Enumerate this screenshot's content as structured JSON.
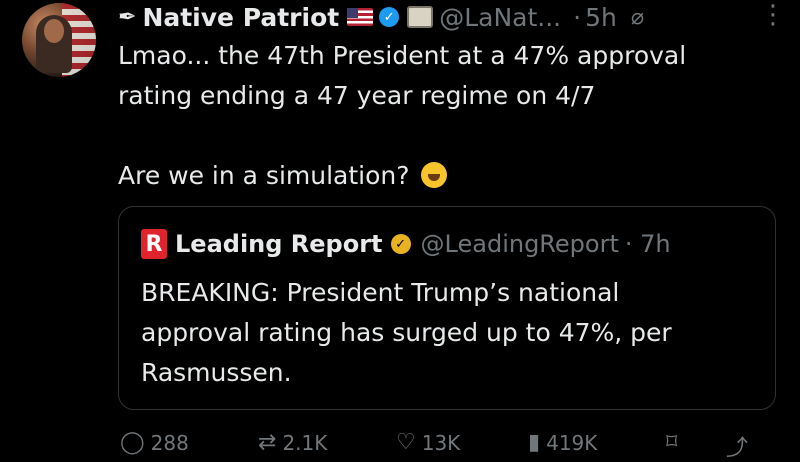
{
  "tweet": {
    "author_name": "Native Patriot",
    "handle": "@LaNat...",
    "dot": "·",
    "time": "5h",
    "lines": [
      "Lmao... the 47th President at a 47% approval",
      "rating ending a 47 year regime on 4/7",
      "Are we in a simulation?"
    ]
  },
  "quote": {
    "logo_letter": "R",
    "author_name": "Leading Report",
    "handle": "@LeadingReport",
    "time": "· 7h",
    "lines": [
      "BREAKING: President Trump’s national",
      "approval rating has surged up to 47%, per",
      "Rasmussen."
    ]
  },
  "actions": {
    "replies": "288",
    "reposts": "2.1K",
    "likes": "13K",
    "views": "419K"
  },
  "icons": {
    "quill": "✒",
    "reply": "◯",
    "repost": "⇄",
    "like": "♡",
    "views": "▮",
    "bookmark": "⌑",
    "share": "⤴",
    "more": "⋮",
    "grok": "⌀"
  },
  "colors": {
    "background": "#000000",
    "text": "#e7e9ea",
    "muted": "#71767b",
    "verified_blue": "#1d9bf0",
    "verified_gold": "#e8b321",
    "brand_red": "#e0242e"
  }
}
